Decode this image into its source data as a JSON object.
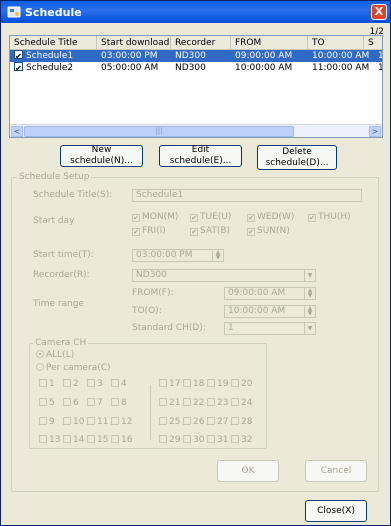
{
  "window": {
    "title": "Schedule",
    "close_glyph": "X",
    "pager": "1/2"
  },
  "list": {
    "columns": [
      "Schedule Title",
      "Start download",
      "Recorder",
      "FROM",
      "TO",
      "S"
    ],
    "rows": [
      {
        "checked": true,
        "title": "Schedule1",
        "start": "03:00:00 PM",
        "recorder": "ND300",
        "from": "09:00:00 AM",
        "to": "10:00:00 AM",
        "extra": "1",
        "selected": true
      },
      {
        "checked": true,
        "title": "Schedule2",
        "start": "05:00:00 AM",
        "recorder": "ND300",
        "from": "10:00:00 AM",
        "to": "11:00:00 AM",
        "extra": "1",
        "selected": false
      }
    ],
    "scroll_left": "<",
    "scroll_right": ">",
    "thumb_grip": "|||"
  },
  "buttons": {
    "new": "New schedule(N)...",
    "edit": "Edit schedule(E)...",
    "delete": "Delete schedule(D)...",
    "ok": "OK",
    "cancel": "Cancel",
    "close": "Close(X)"
  },
  "setup": {
    "group_label": "Schedule Setup",
    "title_label": "Schedule Title(S):",
    "title_value": "Schedule1",
    "start_day_label": "Start day",
    "days": [
      {
        "label": "MON(M)",
        "checked": true
      },
      {
        "label": "TUE(U)",
        "checked": true
      },
      {
        "label": "WED(W)",
        "checked": true
      },
      {
        "label": "THU(H)",
        "checked": true
      },
      {
        "label": "FRI(I)",
        "checked": true
      },
      {
        "label": "SAT(B)",
        "checked": true
      },
      {
        "label": "SUN(N)",
        "checked": true
      }
    ],
    "start_time_label": "Start time(T):",
    "start_time_value": "03:00:00 PM",
    "recorder_label": "Recorder(R):",
    "recorder_value": "ND300",
    "time_range_label": "Time range",
    "from_label": "FROM(F):",
    "from_value": "09:00:00 AM",
    "to_label": "TO(O):",
    "to_value": "10:00:00 AM",
    "standard_ch_label": "Standard CH(D):",
    "standard_ch_value": "1"
  },
  "camera": {
    "group_label": "Camera CH",
    "all_label": "ALL(L)",
    "per_label": "Per camera(C)",
    "channels": [
      "1",
      "2",
      "3",
      "4",
      "17",
      "18",
      "19",
      "20",
      "5",
      "6",
      "7",
      "8",
      "21",
      "22",
      "23",
      "24",
      "9",
      "10",
      "11",
      "12",
      "25",
      "26",
      "27",
      "28",
      "13",
      "14",
      "15",
      "16",
      "29",
      "30",
      "31",
      "32"
    ]
  }
}
